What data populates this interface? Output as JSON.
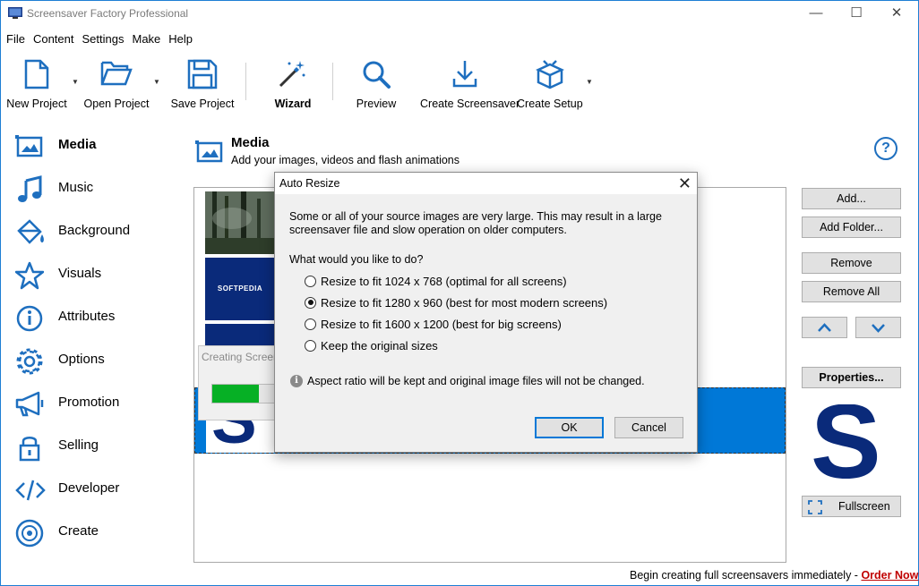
{
  "window": {
    "title": "Screensaver Factory Professional"
  },
  "menu": [
    "File",
    "Content",
    "Settings",
    "Make",
    "Help"
  ],
  "toolbar": {
    "new_project": "New Project",
    "open_project": "Open Project",
    "save_project": "Save Project",
    "wizard": "Wizard",
    "preview": "Preview",
    "create_screensaver": "Create Screensaver",
    "create_setup": "Create Setup"
  },
  "sidebar": {
    "items": [
      {
        "label": "Media",
        "icon": "media-icon",
        "active": true
      },
      {
        "label": "Music",
        "icon": "music-note-icon"
      },
      {
        "label": "Background",
        "icon": "paint-bucket-icon"
      },
      {
        "label": "Visuals",
        "icon": "star-icon"
      },
      {
        "label": "Attributes",
        "icon": "info-icon"
      },
      {
        "label": "Options",
        "icon": "gear-icon"
      },
      {
        "label": "Promotion",
        "icon": "megaphone-icon"
      },
      {
        "label": "Selling",
        "icon": "lock-icon"
      },
      {
        "label": "Developer",
        "icon": "code-icon"
      },
      {
        "label": "Create",
        "icon": "disc-icon"
      }
    ]
  },
  "content": {
    "title": "Media",
    "subtitle": "Add your images, videos and flash animations",
    "help": "?"
  },
  "list": {
    "thumb_label": "SOFTPEDIA"
  },
  "right_panel": {
    "add": "Add...",
    "add_folder": "Add Folder...",
    "remove": "Remove",
    "remove_all": "Remove All",
    "properties": "Properties...",
    "fullscreen": "Fullscreen"
  },
  "progress_popup": {
    "title": "Creating Screen",
    "progress": 0.7
  },
  "dialog": {
    "title": "Auto Resize",
    "message_line1": "Some or all of your source images are very large. This may result in a large",
    "message_line2": "screensaver file and slow operation on older computers.",
    "question": "What would you like to do?",
    "options": [
      {
        "label": "Resize to fit 1024 x 768 (optimal for all screens)",
        "selected": false
      },
      {
        "label": "Resize to fit 1280 x 960 (best for most modern screens)",
        "selected": true
      },
      {
        "label": "Resize to fit 1600 x 1200 (best for big screens)",
        "selected": false
      },
      {
        "label": "Keep the original sizes",
        "selected": false
      }
    ],
    "note": "Aspect ratio will be kept and original image files will not be changed.",
    "ok": "OK",
    "cancel": "Cancel"
  },
  "status": {
    "text": "Begin creating full screensavers immediately - ",
    "link": "Order Now"
  },
  "colors": {
    "accent": "#0078d7",
    "icon_blue": "#1e6fbf",
    "selection": "#0078d7",
    "logo_navy": "#0a2a7a",
    "order_red": "#c00000",
    "progress_green": "#06b025"
  }
}
